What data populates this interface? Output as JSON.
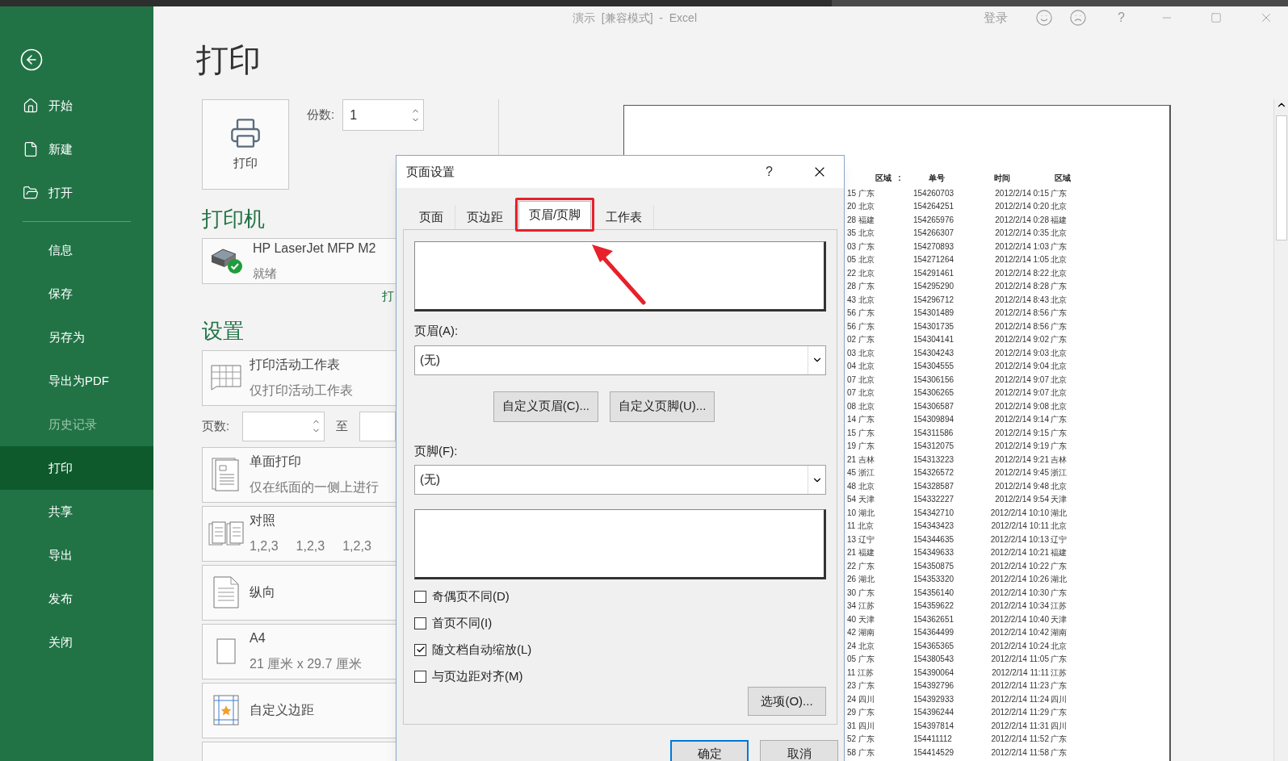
{
  "window": {
    "title": "演示  [兼容模式]  -  Excel",
    "sign_in": "登录",
    "help": "?"
  },
  "sidebar": {
    "top_items": [
      {
        "label": "开始",
        "selected": false,
        "disabled": false
      },
      {
        "label": "新建",
        "selected": false,
        "disabled": false
      },
      {
        "label": "打开",
        "selected": false,
        "disabled": false
      }
    ],
    "items": [
      {
        "label": "信息",
        "selected": false,
        "disabled": false
      },
      {
        "label": "保存",
        "selected": false,
        "disabled": false
      },
      {
        "label": "另存为",
        "selected": false,
        "disabled": false
      },
      {
        "label": "导出为PDF",
        "selected": false,
        "disabled": false
      },
      {
        "label": "历史记录",
        "selected": false,
        "disabled": true
      },
      {
        "label": "打印",
        "selected": true,
        "disabled": false
      },
      {
        "label": "共享",
        "selected": false,
        "disabled": false
      },
      {
        "label": "导出",
        "selected": false,
        "disabled": false
      },
      {
        "label": "发布",
        "selected": false,
        "disabled": false
      },
      {
        "label": "关闭",
        "selected": false,
        "disabled": false
      }
    ]
  },
  "page_title": "打印",
  "print_button": "打印",
  "copies": {
    "label": "份数:",
    "value": "1"
  },
  "printer": {
    "heading": "打印机",
    "name": "HP LaserJet MFP M2",
    "status": "就绪",
    "link": "打"
  },
  "settings": {
    "heading": "设置",
    "cards_top": [
      {
        "kind": "sheet",
        "title": "打印活动工作表",
        "subtitle": "仅打印活动工作表"
      }
    ],
    "pages": {
      "label": "页数:",
      "to": "至"
    },
    "cards": [
      {
        "kind": "sided",
        "title": "单面打印",
        "subtitle": "仅在纸面的一侧上进行"
      },
      {
        "kind": "collate",
        "title": "对照",
        "values": [
          "1,2,3",
          "1,2,3",
          "1,2,3"
        ]
      },
      {
        "kind": "orientation",
        "title": "纵向"
      },
      {
        "kind": "paper",
        "title": "A4",
        "subtitle": "21 厘米 x 29.7 厘米"
      },
      {
        "kind": "margins",
        "title": "自定义边距"
      },
      {
        "kind": "blank"
      }
    ]
  },
  "dialog": {
    "title": "页面设置",
    "help": "?",
    "tabs": [
      {
        "label": "页面",
        "selected": false,
        "highlighted": false
      },
      {
        "label": "页边距",
        "selected": false,
        "highlighted": false
      },
      {
        "label": "页眉/页脚",
        "selected": true,
        "highlighted": true
      },
      {
        "label": "工作表",
        "selected": false,
        "highlighted": false
      }
    ],
    "header_label": "页眉(A):",
    "header_value": "(无)",
    "custom_header": "自定义页眉(C)...",
    "custom_footer": "自定义页脚(U)...",
    "footer_label": "页脚(F):",
    "footer_value": "(无)",
    "checkboxes": [
      {
        "label": "奇偶页不同(D)",
        "checked": false
      },
      {
        "label": "首页不同(I)",
        "checked": false
      },
      {
        "label": "随文档自动缩放(L)",
        "checked": true
      },
      {
        "label": "与页边距对齐(M)",
        "checked": false
      }
    ],
    "options": "选项(O)...",
    "ok": "确定",
    "cancel": "取消"
  },
  "preview": {
    "header": [
      "区域",
      ":",
      "单号",
      "时间",
      "区域"
    ],
    "rows": [
      [
        "15 广东",
        "154260703",
        "2012/2/14 0:15",
        "广东"
      ],
      [
        "20 北京",
        "154264251",
        "2012/2/14 0:20",
        "北京"
      ],
      [
        "28 福建",
        "154265976",
        "2012/2/14 0:28",
        "福建"
      ],
      [
        "35 北京",
        "154266307",
        "2012/2/14 0:35",
        "北京"
      ],
      [
        "03 广东",
        "154270893",
        "2012/2/14 1:03",
        "广东"
      ],
      [
        "05 北京",
        "154271264",
        "2012/2/14 1:05",
        "北京"
      ],
      [
        "22 北京",
        "154291461",
        "2012/2/14 8:22",
        "北京"
      ],
      [
        "28 广东",
        "154295290",
        "2012/2/14 8:28",
        "广东"
      ],
      [
        "43 北京",
        "154296712",
        "2012/2/14 8:43",
        "北京"
      ],
      [
        "56 广东",
        "154301489",
        "2012/2/14 8:56",
        "广东"
      ],
      [
        "56 广东",
        "154301735",
        "2012/2/14 8:56",
        "广东"
      ],
      [
        "02 广东",
        "154304141",
        "2012/2/14 9:02",
        "广东"
      ],
      [
        "03 北京",
        "154304243",
        "2012/2/14 9:03",
        "北京"
      ],
      [
        "04 北京",
        "154304555",
        "2012/2/14 9:04",
        "北京"
      ],
      [
        "07 北京",
        "154306156",
        "2012/2/14 9:07",
        "北京"
      ],
      [
        "07 北京",
        "154306265",
        "2012/2/14 9:07",
        "北京"
      ],
      [
        "08 北京",
        "154306587",
        "2012/2/14 9:08",
        "北京"
      ],
      [
        "14 广东",
        "154309894",
        "2012/2/14 9:14",
        "广东"
      ],
      [
        "15 广东",
        "154311586",
        "2012/2/14 9:15",
        "广东"
      ],
      [
        "19 广东",
        "154312075",
        "2012/2/14 9:19",
        "广东"
      ],
      [
        "21 吉林",
        "154313223",
        "2012/2/14 9:21",
        "吉林"
      ],
      [
        "45 浙江",
        "154326572",
        "2012/2/14 9:45",
        "浙江"
      ],
      [
        "48 北京",
        "154328587",
        "2012/2/14 9:48",
        "北京"
      ],
      [
        "54 天津",
        "154332227",
        "2012/2/14 9:54",
        "天津"
      ],
      [
        "10 湖北",
        "154342710",
        "2012/2/14 10:10",
        "湖北"
      ],
      [
        "11 北京",
        "154343423",
        "2012/2/14 10:11",
        "北京"
      ],
      [
        "13 辽宁",
        "154344635",
        "2012/2/14 10:13",
        "辽宁"
      ],
      [
        "21 福建",
        "154349633",
        "2012/2/14 10:21",
        "福建"
      ],
      [
        "22 广东",
        "154350875",
        "2012/2/14 10:22",
        "广东"
      ],
      [
        "26 湖北",
        "154353320",
        "2012/2/14 10:26",
        "湖北"
      ],
      [
        "30 广东",
        "154356140",
        "2012/2/14 10:30",
        "广东"
      ],
      [
        "34 江苏",
        "154359622",
        "2012/2/14 10:34",
        "江苏"
      ],
      [
        "40 天津",
        "154362651",
        "2012/2/14 10:40",
        "天津"
      ],
      [
        "42 湖南",
        "154364499",
        "2012/2/14 10:42",
        "湖南"
      ],
      [
        "24 北京",
        "154365365",
        "2012/2/14 10:24",
        "北京"
      ],
      [
        "05 广东",
        "154380543",
        "2012/2/14 11:05",
        "广东"
      ],
      [
        "11 江苏",
        "154390064",
        "2012/2/14 11:11",
        "江苏"
      ],
      [
        "23 广东",
        "154392796",
        "2012/2/14 11:23",
        "广东"
      ],
      [
        "24 四川",
        "154392933",
        "2012/2/14 11:24",
        "四川"
      ],
      [
        "29 广东",
        "154396244",
        "2012/2/14 11:29",
        "广东"
      ],
      [
        "31 四川",
        "154397814",
        "2012/2/14 11:31",
        "四川"
      ],
      [
        "52 广东",
        "154411112",
        "2012/2/14 11:52",
        "广东"
      ],
      [
        "58 广东",
        "154414529",
        "2012/2/14 11:58",
        "广东"
      ]
    ]
  }
}
